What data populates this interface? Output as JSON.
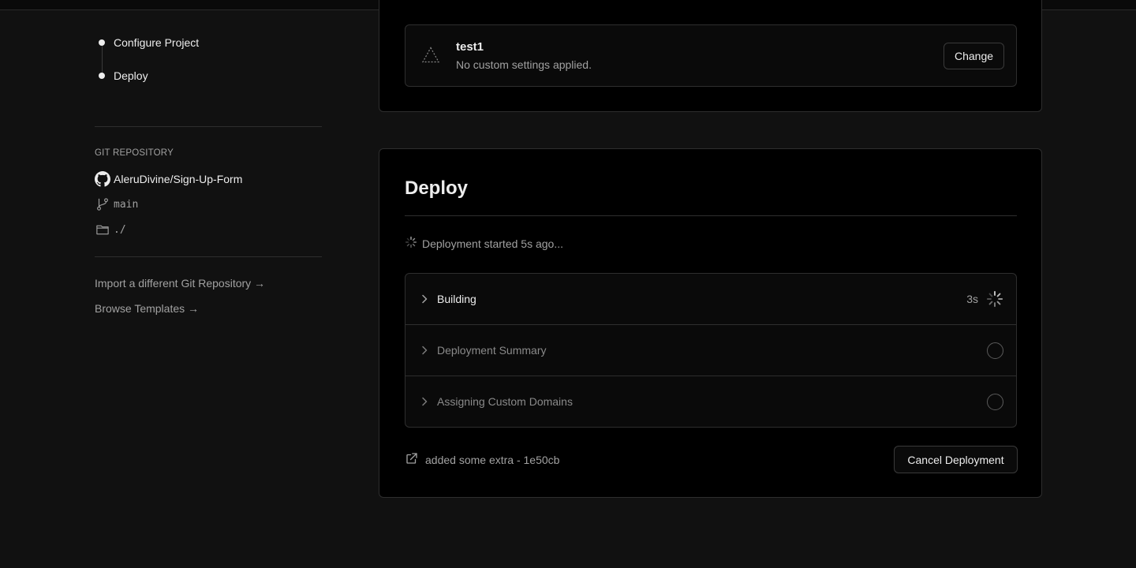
{
  "steps": [
    {
      "label": "Configure Project"
    },
    {
      "label": "Deploy"
    }
  ],
  "repository": {
    "heading": "GIT REPOSITORY",
    "name": "AleruDivine/Sign-Up-Form",
    "branch": "main",
    "directory": "./"
  },
  "links": {
    "import": "Import a different Git Repository →",
    "templates": "Browse Templates →"
  },
  "preset": {
    "name": "test1",
    "description": "No custom settings applied.",
    "change_label": "Change"
  },
  "deploy": {
    "title": "Deploy",
    "status": "Deployment started 5s ago...",
    "steps": [
      {
        "label": "Building",
        "time": "3s",
        "state": "running"
      },
      {
        "label": "Deployment Summary",
        "time": "",
        "state": "pending"
      },
      {
        "label": "Assigning Custom Domains",
        "time": "",
        "state": "pending"
      }
    ],
    "commit": "added some extra - 1e50cb",
    "cancel_label": "Cancel Deployment"
  },
  "icons": {
    "github": "github-icon",
    "branch": "git-branch-icon",
    "folder": "folder-icon",
    "spinner": "spinner-icon",
    "chevron": "chevron-right-icon",
    "external": "external-link-icon",
    "preset": "framework-preset-icon"
  },
  "colors": {
    "background": "#111111",
    "card": "#000000",
    "border": "#2e2e2e",
    "text": "#ededed",
    "muted": "#a1a1a1"
  }
}
